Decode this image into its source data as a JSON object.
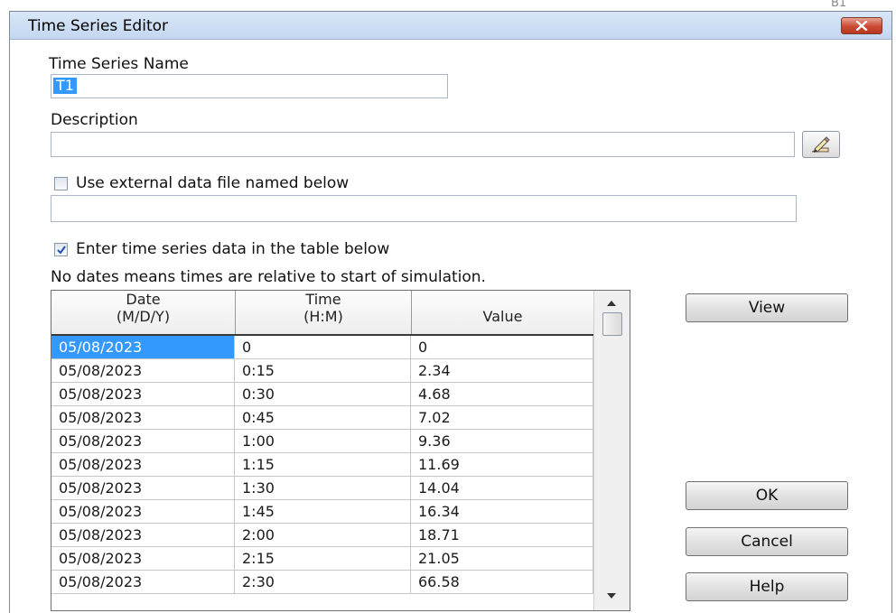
{
  "background_text": "B1",
  "window": {
    "title": "Time Series Editor"
  },
  "name": {
    "label": "Time Series Name",
    "value": "T1"
  },
  "description": {
    "label": "Description",
    "value": ""
  },
  "external_file": {
    "label": "Use external data file named below",
    "checked": false,
    "value": ""
  },
  "table_entry": {
    "label": "Enter time series data in the table below",
    "checked": true
  },
  "note": "No dates means times are relative to start of simulation.",
  "table": {
    "headers": [
      {
        "line1": "Date",
        "line2": "(M/D/Y)"
      },
      {
        "line1": "Time",
        "line2": "(H:M)"
      },
      {
        "line1": "",
        "line2": "Value"
      }
    ],
    "rows": [
      [
        "05/08/2023",
        "0",
        "0"
      ],
      [
        "05/08/2023",
        "0:15",
        "2.34"
      ],
      [
        "05/08/2023",
        "0:30",
        "4.68"
      ],
      [
        "05/08/2023",
        "0:45",
        "7.02"
      ],
      [
        "05/08/2023",
        "1:00",
        "9.36"
      ],
      [
        "05/08/2023",
        "1:15",
        "11.69"
      ],
      [
        "05/08/2023",
        "1:30",
        "14.04"
      ],
      [
        "05/08/2023",
        "1:45",
        "16.34"
      ],
      [
        "05/08/2023",
        "2:00",
        "18.71"
      ],
      [
        "05/08/2023",
        "2:15",
        "21.05"
      ],
      [
        "05/08/2023",
        "2:30",
        "66.58"
      ]
    ]
  },
  "buttons": {
    "view": "View",
    "ok": "OK",
    "cancel": "Cancel",
    "help": "Help"
  },
  "colors": {
    "selection": "#3399ff",
    "close_button": "#c94a33",
    "titlebar": "#c3d7f0"
  },
  "icons": {
    "close": "close-icon",
    "browse": "hand-pencil-icon",
    "checkbox": "checkmark-icon"
  }
}
